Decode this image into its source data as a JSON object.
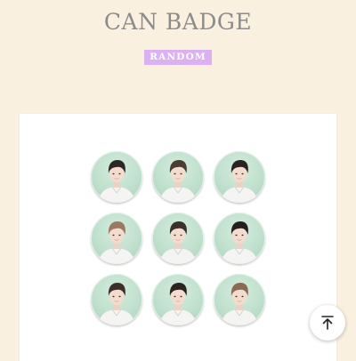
{
  "page": {
    "title": "CAN BADGE",
    "badge_label": "RANDOM"
  },
  "product": {
    "badges": [
      {
        "hair": "#2c2624"
      },
      {
        "hair": "#4a3b33"
      },
      {
        "hair": "#2a2421"
      },
      {
        "hair": "#9a7a62"
      },
      {
        "hair": "#3b302b"
      },
      {
        "hair": "#23201e"
      },
      {
        "hair": "#3c302a"
      },
      {
        "hair": "#2b2522"
      },
      {
        "hair": "#8a6a52"
      }
    ]
  },
  "colors": {
    "background": "#f9f0e0",
    "title": "#8c8c8c",
    "badge_bg": "#dcb1f2",
    "badge_text": "#ffffff",
    "pin_green": "#bfe0cc"
  },
  "icons": {
    "scroll_top": "arrow-up-to-line-icon"
  }
}
